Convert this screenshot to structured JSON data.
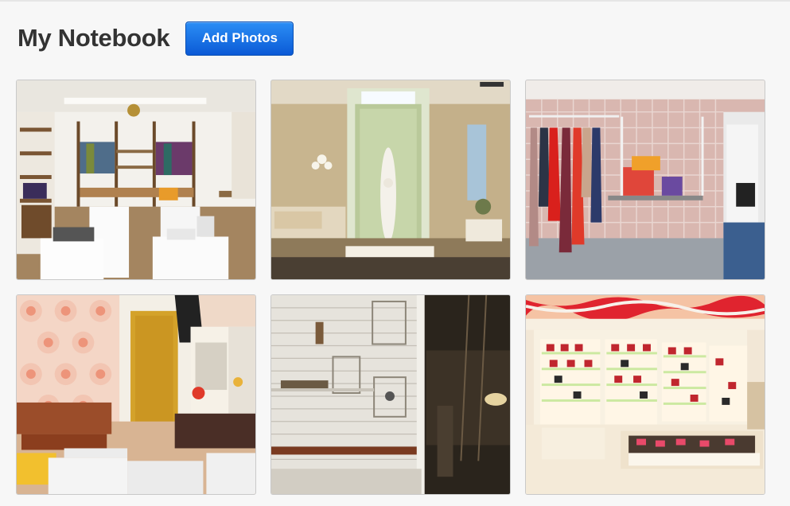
{
  "page": {
    "title": "My Notebook",
    "add_button_label": "Add Photos"
  },
  "colors": {
    "background": "#f7f7f7",
    "button_top": "#2b8ef5",
    "button_bottom": "#0b5ad6",
    "title": "#333333"
  },
  "photos": [
    {
      "scene": "boutique with wooden shelving and white display plinths"
    },
    {
      "scene": "lit glass display case with mannequin in white gown"
    },
    {
      "scene": "pink tiled wall with hanging garments and shelf of bags"
    },
    {
      "scene": "retro shop with floral wallpaper and wooden desk"
    },
    {
      "scene": "white painted brick wall with frames and shelves"
    },
    {
      "scene": "handbag store with illuminated shelving and counter"
    }
  ]
}
